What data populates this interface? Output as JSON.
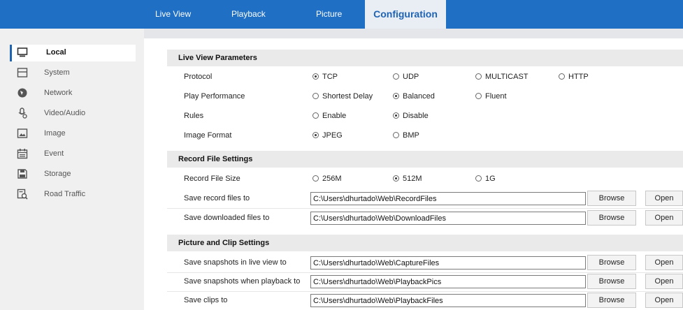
{
  "topnav": {
    "tabs": [
      {
        "label": "Live View"
      },
      {
        "label": "Playback"
      },
      {
        "label": "Picture"
      },
      {
        "label": "Configuration",
        "active": true
      }
    ]
  },
  "sidebar": {
    "items": [
      {
        "label": "Local",
        "icon": "monitor-icon",
        "active": true
      },
      {
        "label": "System",
        "icon": "system-icon"
      },
      {
        "label": "Network",
        "icon": "network-icon"
      },
      {
        "label": "Video/Audio",
        "icon": "video-audio-icon"
      },
      {
        "label": "Image",
        "icon": "image-icon"
      },
      {
        "label": "Event",
        "icon": "calendar-icon"
      },
      {
        "label": "Storage",
        "icon": "storage-icon"
      },
      {
        "label": "Road Traffic",
        "icon": "road-traffic-icon"
      }
    ]
  },
  "live_view": {
    "title": "Live View Parameters",
    "protocol": {
      "label": "Protocol",
      "options": [
        "TCP",
        "UDP",
        "MULTICAST",
        "HTTP"
      ],
      "selected": "TCP"
    },
    "play_performance": {
      "label": "Play Performance",
      "options": [
        "Shortest Delay",
        "Balanced",
        "Fluent"
      ],
      "selected": "Balanced"
    },
    "rules": {
      "label": "Rules",
      "options": [
        "Enable",
        "Disable"
      ],
      "selected": "Disable"
    },
    "image_format": {
      "label": "Image Format",
      "options": [
        "JPEG",
        "BMP"
      ],
      "selected": "JPEG"
    }
  },
  "record": {
    "title": "Record File Settings",
    "file_size": {
      "label": "Record File Size",
      "options": [
        "256M",
        "512M",
        "1G"
      ],
      "selected": "512M"
    },
    "save_record": {
      "label": "Save record files to",
      "value": "C:\\Users\\dhurtado\\Web\\RecordFiles"
    },
    "save_downloaded": {
      "label": "Save downloaded files to",
      "value": "C:\\Users\\dhurtado\\Web\\DownloadFiles"
    }
  },
  "picture": {
    "title": "Picture and Clip Settings",
    "snap_live": {
      "label": "Save snapshots in live view to",
      "value": "C:\\Users\\dhurtado\\Web\\CaptureFiles"
    },
    "snap_playback": {
      "label": "Save snapshots when playback to",
      "value": "C:\\Users\\dhurtado\\Web\\PlaybackPics"
    },
    "clips": {
      "label": "Save clips to",
      "value": "C:\\Users\\dhurtado\\Web\\PlaybackFiles"
    }
  },
  "buttons": {
    "browse": "Browse",
    "open": "Open"
  },
  "colors": {
    "nav_bg": "#1f6fc4",
    "active_tab_bg": "#e9eef4",
    "active_text": "#1f63b4",
    "sidebar_bg": "#f0f0f0",
    "section_bg": "#eaeaea"
  }
}
